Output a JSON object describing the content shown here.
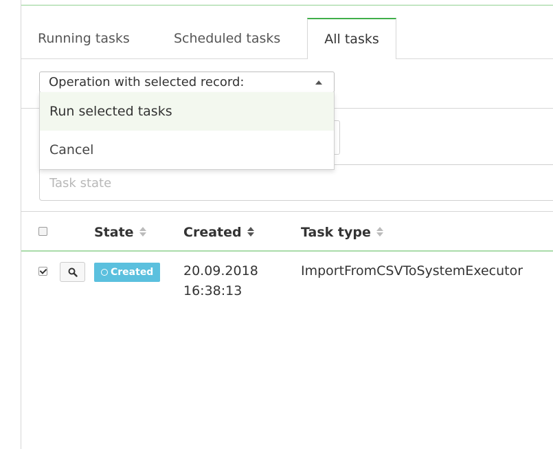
{
  "tabs": [
    {
      "label": "Running tasks",
      "active": false
    },
    {
      "label": "Scheduled tasks",
      "active": false
    },
    {
      "label": "All tasks",
      "active": true
    }
  ],
  "operation_select": {
    "selected_label": "Operation with selected record:",
    "options": [
      "Run selected tasks",
      "Cancel"
    ],
    "highlighted_option": "Run selected tasks"
  },
  "filter": {
    "task_state_placeholder": "Task state"
  },
  "table": {
    "columns": [
      "State",
      "Created",
      "Task type"
    ],
    "rows": [
      {
        "selected": true,
        "view_icon": "search-icon",
        "state": "Created",
        "state_icon": "circle-outline-icon",
        "created_date": "20.09.2018",
        "created_time": "16:38:13",
        "task_type": "ImportFromCSVToSystemExecutor"
      }
    ]
  },
  "colors": {
    "accent_green": "#3fae49",
    "state_badge": "#5bc0de",
    "menu_highlight": "#f3f8ef"
  }
}
